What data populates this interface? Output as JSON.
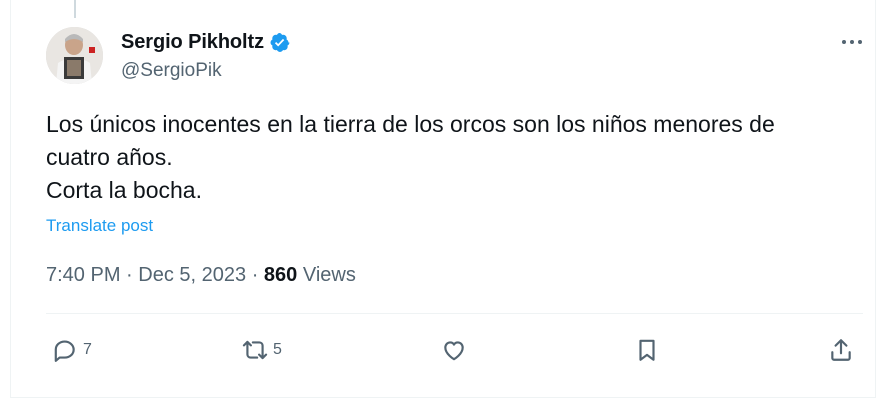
{
  "author": {
    "display_name": "Sergio Pikholtz",
    "handle": "@SergioPik",
    "verified": true,
    "avatar_icon": "avatar-photo"
  },
  "tweet": {
    "lines": [
      "Los únicos inocentes en la tierra de los orcos son los niños menores de",
      "cuatro años.",
      "Corta la bocha."
    ],
    "translate_label": "Translate post",
    "time": "7:40 PM",
    "separator": "·",
    "date": "Dec 5, 2023",
    "views_count": "860",
    "views_label": "Views"
  },
  "actions": {
    "reply_count": "7",
    "retweet_count": "5",
    "like_icon": "heart-icon",
    "bookmark_icon": "bookmark-icon",
    "share_icon": "share-icon"
  },
  "colors": {
    "accent": "#1d9bf0",
    "text": "#0f1419",
    "secondary": "#536471",
    "border": "#eff3f4"
  }
}
